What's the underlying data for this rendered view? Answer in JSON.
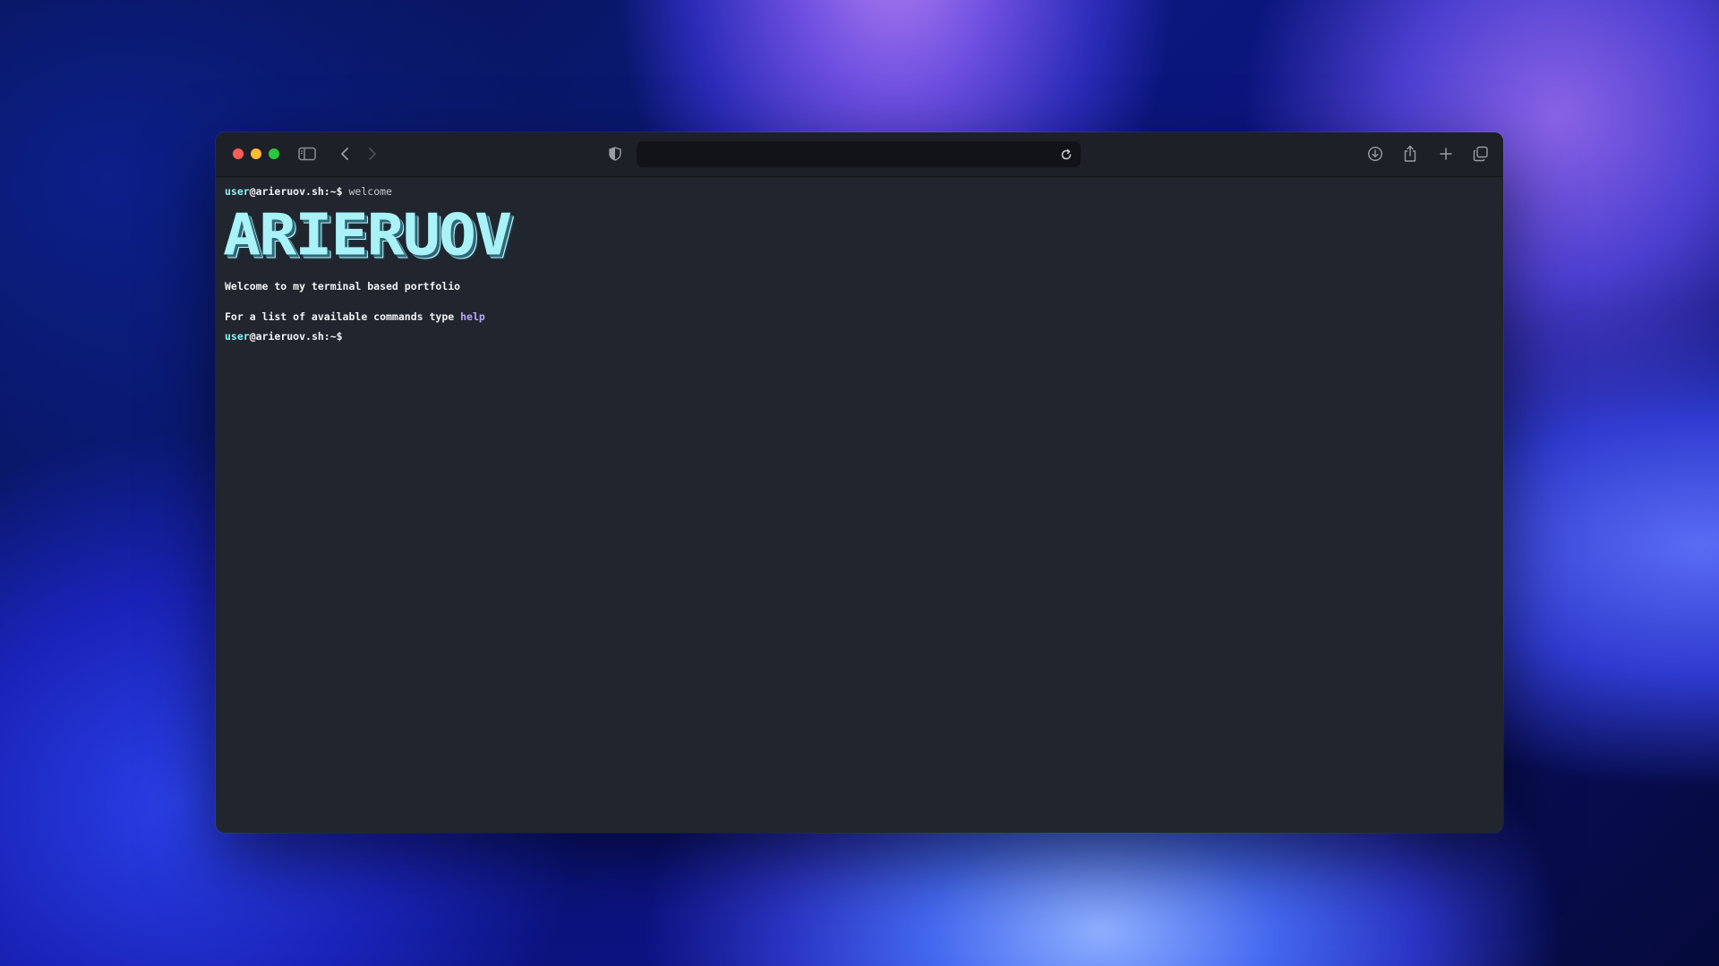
{
  "window": {
    "url_value": ""
  },
  "toolbar": {
    "icons": [
      "sidebar-icon",
      "back-icon",
      "forward-icon",
      "shield-icon",
      "reload-icon",
      "download-icon",
      "share-icon",
      "new-tab-icon",
      "tabs-overview-icon"
    ]
  },
  "terminal": {
    "prompt_user": "user",
    "prompt_host": "@arieruov.sh:~$",
    "first_command": "welcome",
    "banner": "ARIERUOV",
    "welcome_line": "Welcome to my terminal based portfolio",
    "help_prefix": "For a list of available commands type ",
    "help_keyword": "help"
  },
  "colors": {
    "prompt_user": "#8ef0f4",
    "banner": "#a8f2f8",
    "help_keyword": "#b7a9ff",
    "terminal_bg": "#21252e"
  }
}
